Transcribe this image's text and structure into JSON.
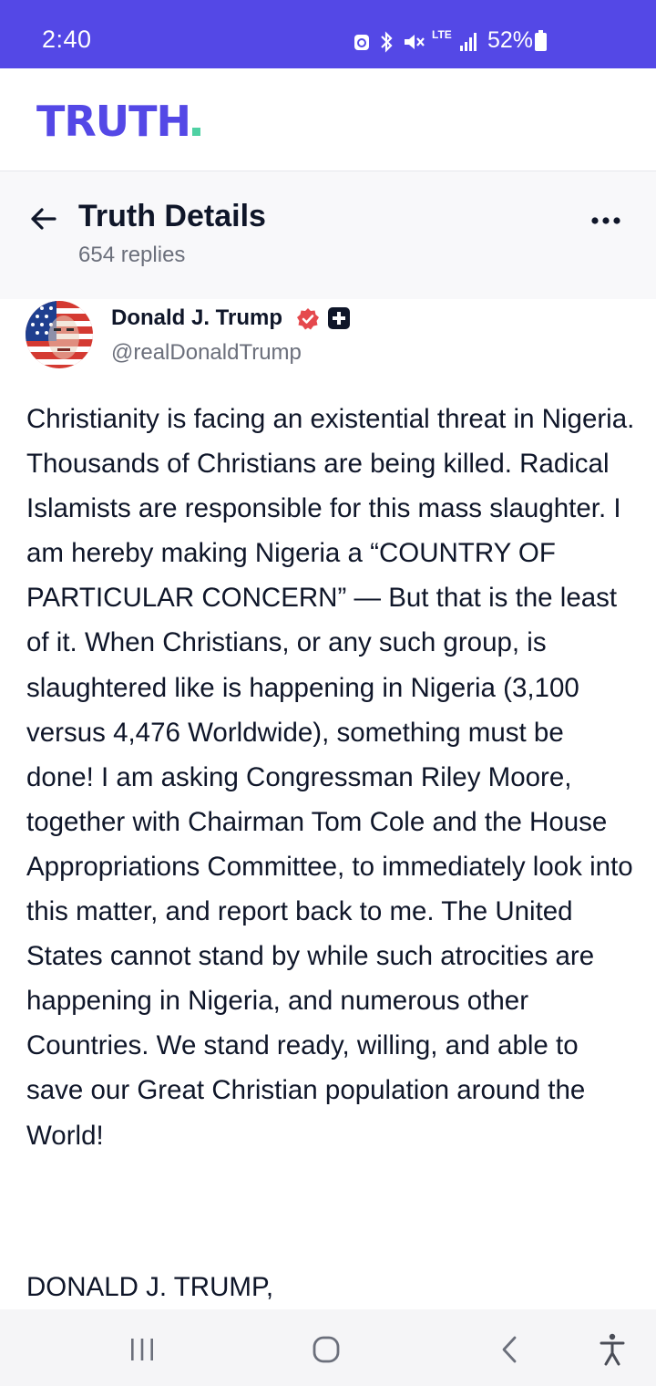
{
  "status_bar": {
    "time": "2:40",
    "battery": "52%",
    "icons": [
      "data-saver-icon",
      "bluetooth-icon",
      "mute-icon",
      "lte-icon",
      "signal-icon",
      "battery-icon"
    ],
    "network_label": "LTE"
  },
  "brand": {
    "logo_text": "TRUTH",
    "logo_color": "#5448e6",
    "logo_dot_color": "#4fd1a3"
  },
  "header": {
    "title": "Truth Details",
    "replies": "654 replies",
    "back_icon": "arrow-left-icon",
    "more_icon": "more-horizontal-icon"
  },
  "post": {
    "author_name": "Donald J. Trump",
    "handle": "@realDonaldTrump",
    "verified_icon": "verified-badge-icon",
    "verified_color": "#e5484d",
    "badge_icon": "plus-badge-icon",
    "body": "Christianity is facing an existential threat in Nigeria. Thousands of Christians are being killed. Radical Islamists are responsible for this mass slaughter. I am hereby making Nigeria a “COUNTRY OF PARTICULAR CONCERN” — But that is the least of it. When Christians, or any such group, is slaughtered like is happening in Nigeria (3,100 versus 4,476 Worldwide), something must be done! I am asking Congressman Riley Moore, together with Chairman Tom Cole and the House Appropriations Committee, to immediately look into this matter, and report back to me. The United States cannot stand by while such atrocities are happening in Nigeria, and numerous other Countries. We stand ready, willing, and able to save our Great Christian population around the World!",
    "signature": "DONALD J. TRUMP,"
  },
  "nav_bar": {
    "buttons": [
      "recent-apps-icon",
      "home-icon",
      "back-icon",
      "accessibility-icon"
    ]
  },
  "colors": {
    "accent": "#5448e6",
    "text": "#0f1629",
    "muted": "#6b6f7b"
  }
}
